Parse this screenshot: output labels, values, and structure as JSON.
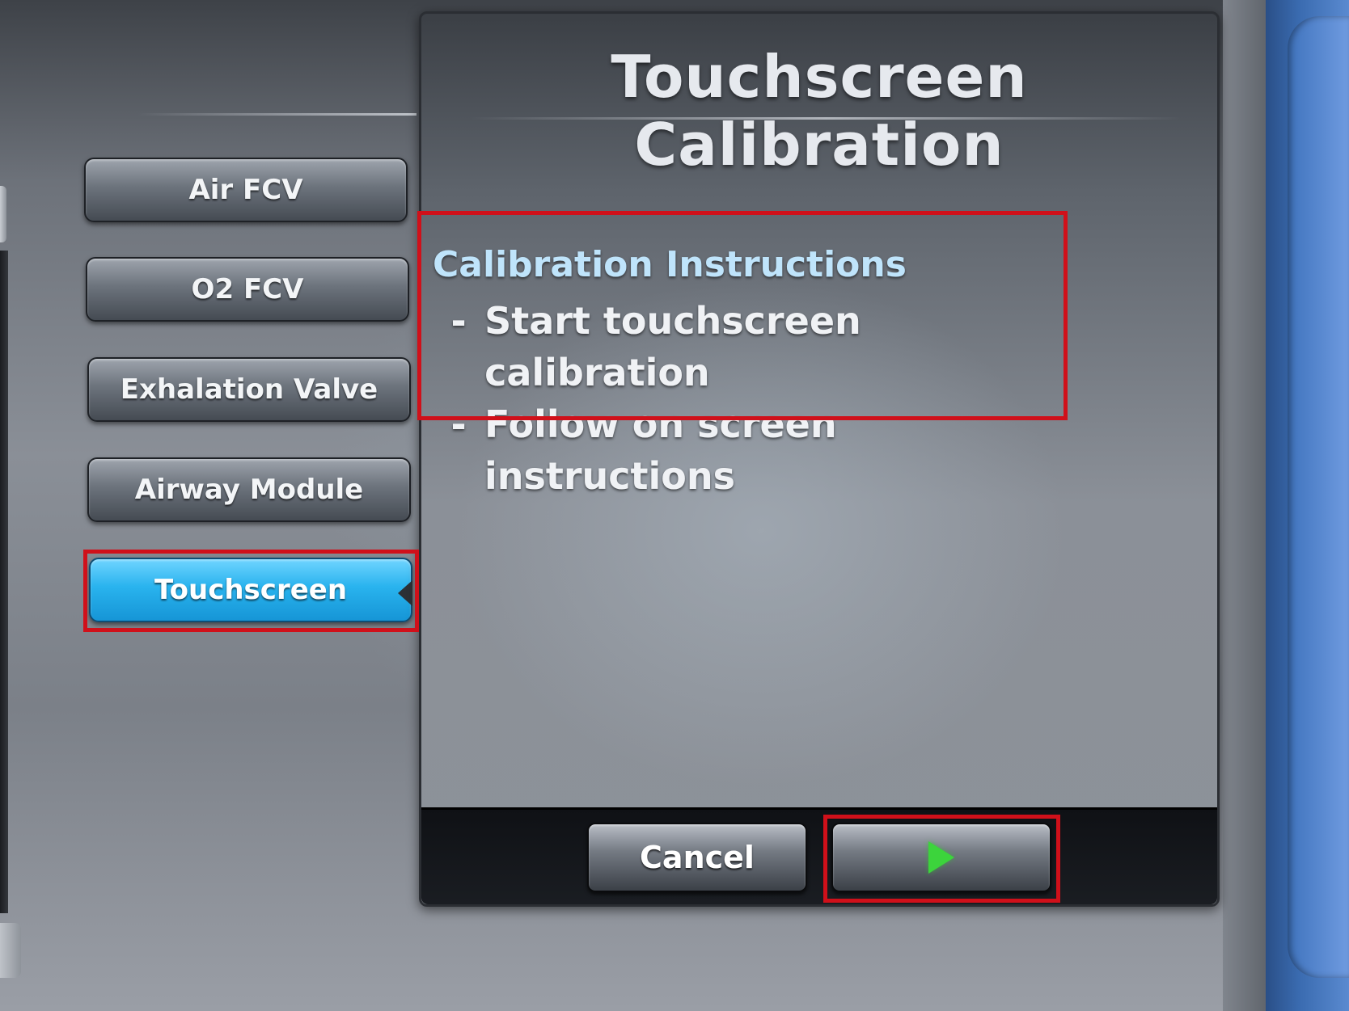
{
  "sidebar": {
    "items": [
      {
        "label": "Air FCV",
        "active": false
      },
      {
        "label": "O2 FCV",
        "active": false
      },
      {
        "label": "Exhalation Valve",
        "active": false
      },
      {
        "label": "Airway Module",
        "active": false
      },
      {
        "label": "Touchscreen",
        "active": true
      }
    ]
  },
  "dialog": {
    "title": "Touchscreen Calibration",
    "instructions": {
      "heading": "Calibration Instructions",
      "dash": "-",
      "steps": [
        "Start touchscreen calibration",
        "Follow on screen instructions"
      ]
    },
    "buttons": {
      "cancel_label": "Cancel",
      "start_icon": "play-icon"
    }
  },
  "colors": {
    "highlight": "#d0101a",
    "active_button": "#29b3ee",
    "start_arrow": "#3cd43c",
    "heading_text": "#bfe4fb"
  }
}
